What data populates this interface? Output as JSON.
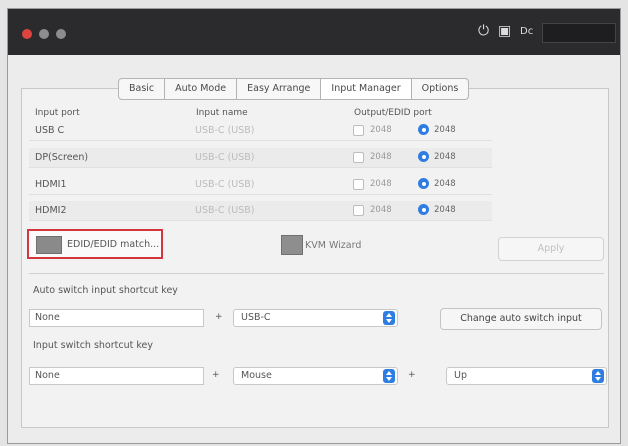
{
  "titlebar": {
    "text": "Dc"
  },
  "tabs": [
    {
      "label": "Basic"
    },
    {
      "label": "Auto Mode"
    },
    {
      "label": "Easy Arrange"
    },
    {
      "label": "Input Manager"
    },
    {
      "label": "Options"
    }
  ],
  "table": {
    "headers": {
      "port": "Input port",
      "name": "Input name",
      "edid": "Output/EDID port"
    },
    "rows": [
      {
        "port": "USB C",
        "name": "USB-C (USB)",
        "check_label": "2048",
        "radio_label": "2048"
      },
      {
        "port": "DP(Screen)",
        "name": "USB-C (USB)",
        "check_label": "2048",
        "radio_label": "2048"
      },
      {
        "port": "HDMI1",
        "name": "USB-C (USB)",
        "check_label": "2048",
        "radio_label": "2048"
      },
      {
        "port": "HDMI2",
        "name": "USB-C (USB)",
        "check_label": "2048",
        "radio_label": "2048"
      }
    ]
  },
  "edid_button": {
    "label": "EDID/EDID match..."
  },
  "kvm_wizard": {
    "label": "KVM Wizard"
  },
  "apply_button": {
    "label": "Apply"
  },
  "shortcut1": {
    "title": "Auto switch input shortcut key",
    "key_value": "None",
    "plus": "+",
    "combo_value": "USB-C",
    "button_label": "Change auto switch input"
  },
  "shortcut2": {
    "title": "Input switch shortcut key",
    "key_value": "None",
    "plus1": "+",
    "combo1_value": "Mouse",
    "plus2": "+",
    "combo2_value": "Up"
  },
  "colors": {
    "accent": "#2f7de1",
    "highlight": "#d5353d",
    "titlebar": "#2b2b2d"
  }
}
